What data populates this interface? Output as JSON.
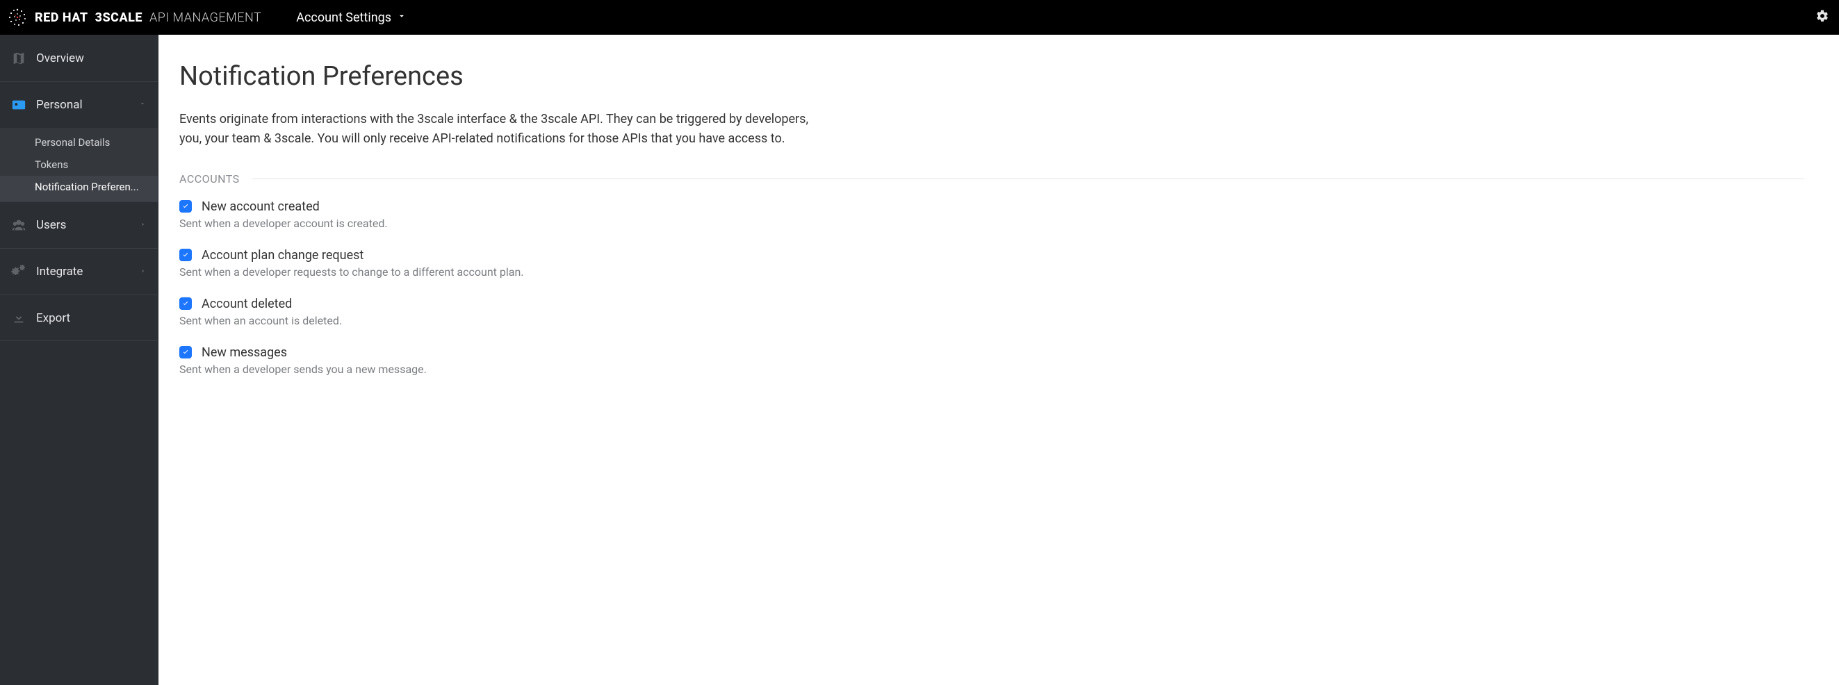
{
  "header": {
    "brand1": "RED HAT",
    "brand2": "3SCALE",
    "brand3": "API MANAGEMENT",
    "menu_label": "Account Settings"
  },
  "sidebar": {
    "items": [
      {
        "label": "Overview"
      },
      {
        "label": "Personal",
        "sub": [
          {
            "label": "Personal Details"
          },
          {
            "label": "Tokens"
          },
          {
            "label": "Notification Preferen..."
          }
        ]
      },
      {
        "label": "Users"
      },
      {
        "label": "Integrate"
      },
      {
        "label": "Export"
      }
    ]
  },
  "main": {
    "title": "Notification Preferences",
    "intro": "Events originate from interactions with the 3scale interface & the 3scale API. They can be triggered by developers, you, your team & 3scale. You will only receive API-related notifications for those APIs that you have access to.",
    "sections": [
      {
        "label": "ACCOUNTS",
        "prefs": [
          {
            "title": "New account created",
            "desc": "Sent when a developer account is created.",
            "checked": true
          },
          {
            "title": "Account plan change request",
            "desc": "Sent when a developer requests to change to a different account plan.",
            "checked": true
          },
          {
            "title": "Account deleted",
            "desc": "Sent when an account is deleted.",
            "checked": true
          },
          {
            "title": "New messages",
            "desc": "Sent when a developer sends you a new message.",
            "checked": true
          }
        ]
      }
    ]
  }
}
